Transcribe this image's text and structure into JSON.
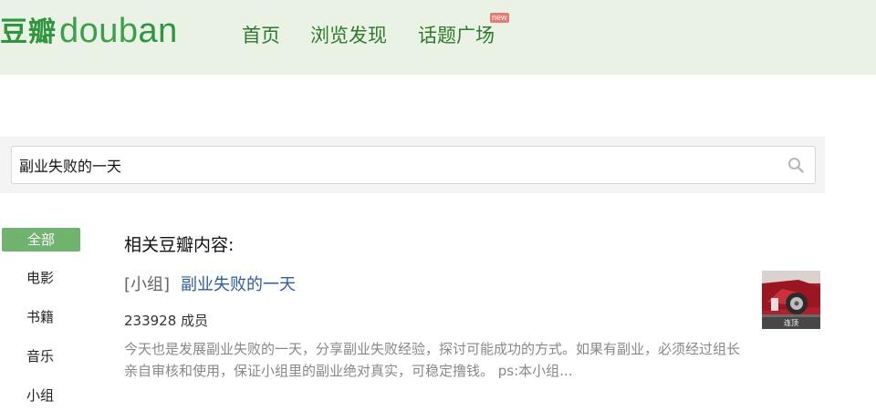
{
  "header": {
    "logo_cn": "豆瓣",
    "logo_en_prefix": "doub",
    "logo_en_suffix": "an",
    "nav": [
      {
        "label": "首页"
      },
      {
        "label": "浏览发现"
      },
      {
        "label": "话题广场"
      }
    ],
    "new_badge": "new"
  },
  "search": {
    "value": "副业失败的一天"
  },
  "sidebar": {
    "items": [
      {
        "label": "全部",
        "active": true
      },
      {
        "label": "电影"
      },
      {
        "label": "书籍"
      },
      {
        "label": "音乐"
      },
      {
        "label": "小组"
      }
    ]
  },
  "results": {
    "heading": "相关豆瓣内容:",
    "items": [
      {
        "category": "[小组]",
        "title": "副业失败的一天",
        "members": "233928 成员",
        "description": "今天也是发展副业失败的一天，分享副业失败经验，探讨可能成功的方式。如果有副业，必须经过组长亲自审核和使用，保证小组里的副业绝对真实，可稳定撸钱。 ps:本小组...",
        "thumb_caption": "连顶"
      }
    ]
  },
  "colors": {
    "header_bg": "#eaf2e6",
    "brand_green": "#2e963d",
    "nav_green": "#2f7a2a",
    "active_tab": "#6fb36f",
    "link_blue": "#2b5ea8"
  }
}
